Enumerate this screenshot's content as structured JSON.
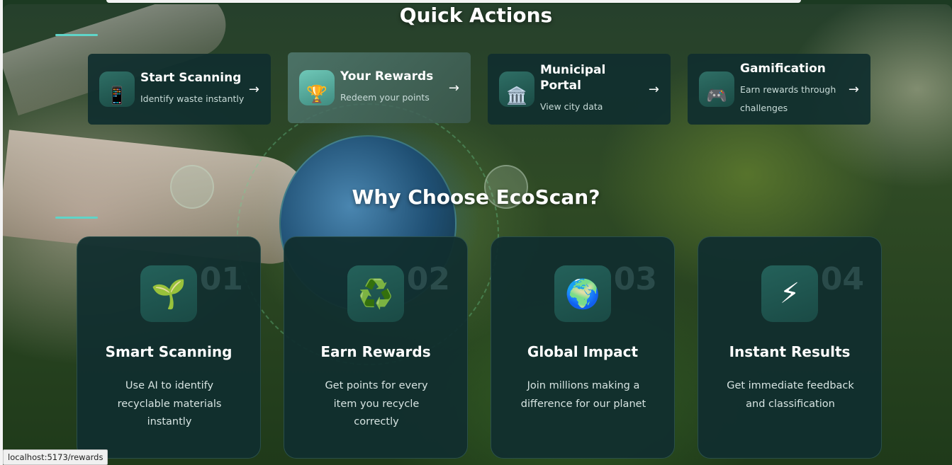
{
  "quick_actions": {
    "title": "Quick Actions",
    "cards": [
      {
        "icon": "mobile-phone-icon",
        "glyph": "📱",
        "title": "Start Scanning",
        "subtitle": "Identify waste instantly",
        "arrow": "→"
      },
      {
        "icon": "trophy-icon",
        "glyph": "🏆",
        "title": "Your Rewards",
        "subtitle": "Redeem your points",
        "arrow": "→"
      },
      {
        "icon": "bank-building-icon",
        "glyph": "🏛️",
        "title": "Municipal Portal",
        "subtitle": "View city data",
        "arrow": "→"
      },
      {
        "icon": "game-controller-icon",
        "glyph": "🎮",
        "title": "Gamification",
        "subtitle": "Earn rewards through challenges",
        "arrow": "→"
      }
    ]
  },
  "why": {
    "title": "Why Choose EcoScan?",
    "features": [
      {
        "number": "01",
        "icon": "seedling-icon",
        "glyph": "🌱",
        "title": "Smart Scanning",
        "description": "Use AI to identify recyclable materials instantly"
      },
      {
        "number": "02",
        "icon": "recycle-icon",
        "glyph": "♻️",
        "title": "Earn Rewards",
        "description": "Get points for every item you recycle correctly"
      },
      {
        "number": "03",
        "icon": "globe-icon",
        "glyph": "🌍",
        "title": "Global Impact",
        "description": "Join millions making a difference for our planet"
      },
      {
        "number": "04",
        "icon": "lightning-icon",
        "glyph": "⚡",
        "title": "Instant Results",
        "description": "Get immediate feedback and classification"
      }
    ]
  },
  "status_bar": {
    "url": "localhost:5173/rewards"
  },
  "colors": {
    "accent": "#5fd4c8",
    "card_bg": "#102e2e"
  }
}
